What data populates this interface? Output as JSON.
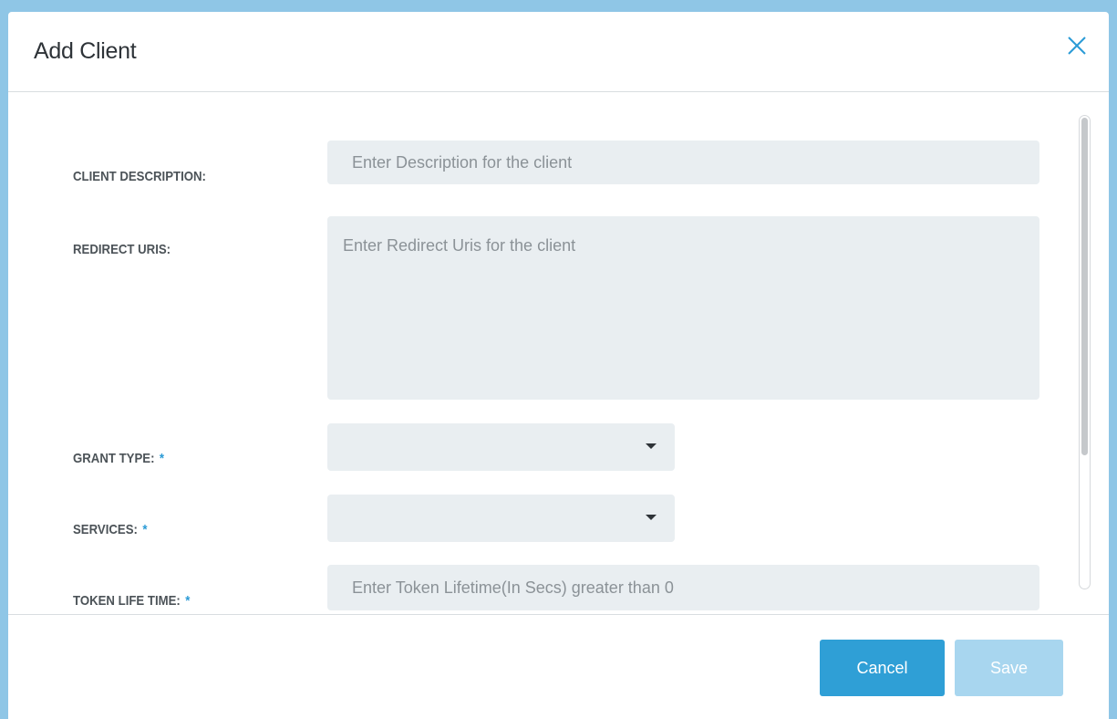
{
  "modal": {
    "title": "Add Client"
  },
  "form": {
    "client_description": {
      "label": "CLIENT DESCRIPTION:",
      "placeholder": "Enter Description for the client",
      "value": ""
    },
    "redirect_uris": {
      "label": "REDIRECT URIS:",
      "placeholder": "Enter Redirect Uris for the client",
      "value": ""
    },
    "grant_type": {
      "label": "GRANT TYPE:",
      "required_marker": "*",
      "selected": ""
    },
    "services": {
      "label": "SERVICES:",
      "required_marker": "*",
      "selected": ""
    },
    "token_lifetime": {
      "label": "TOKEN LIFE TIME:",
      "required_marker": "*",
      "placeholder": "Enter Token Lifetime(In Secs) greater than 0",
      "value": ""
    }
  },
  "footer": {
    "cancel_label": "Cancel",
    "save_label": "Save"
  },
  "icons": {
    "close": "close-icon",
    "dropdown": "caret-down-icon"
  },
  "colors": {
    "primary": "#2f9fd6",
    "primary_disabled": "#a8d6ef",
    "required": "#2b9bd6",
    "input_bg": "#e9eef1",
    "backdrop": "#8fc6e6"
  }
}
